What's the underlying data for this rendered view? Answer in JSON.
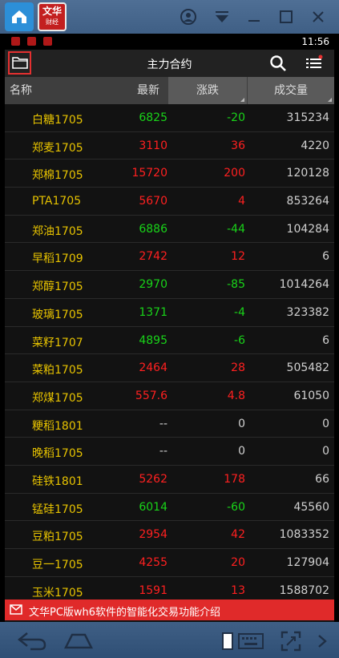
{
  "host": {
    "app_badge_line1": "文华",
    "app_badge_line2": "财经"
  },
  "status": {
    "time": "11:56"
  },
  "appbar": {
    "title": "主力合约"
  },
  "table": {
    "headers": {
      "name": "名称",
      "latest": "最新",
      "change": "涨跌",
      "volume": "成交量"
    },
    "rows": [
      {
        "name": "白糖1705",
        "latest": "6825",
        "change": "-20",
        "volume": "315234",
        "dir": "down"
      },
      {
        "name": "郑麦1705",
        "latest": "3110",
        "change": "36",
        "volume": "4220",
        "dir": "up"
      },
      {
        "name": "郑棉1705",
        "latest": "15720",
        "change": "200",
        "volume": "120128",
        "dir": "up"
      },
      {
        "name": "PTA1705",
        "latest": "5670",
        "change": "4",
        "volume": "853264",
        "dir": "up"
      },
      {
        "name": "郑油1705",
        "latest": "6886",
        "change": "-44",
        "volume": "104284",
        "dir": "down"
      },
      {
        "name": "早稻1709",
        "latest": "2742",
        "change": "12",
        "volume": "6",
        "dir": "up"
      },
      {
        "name": "郑醇1705",
        "latest": "2970",
        "change": "-85",
        "volume": "1014264",
        "dir": "down"
      },
      {
        "name": "玻璃1705",
        "latest": "1371",
        "change": "-4",
        "volume": "323382",
        "dir": "down"
      },
      {
        "name": "菜籽1707",
        "latest": "4895",
        "change": "-6",
        "volume": "6",
        "dir": "down"
      },
      {
        "name": "菜粕1705",
        "latest": "2464",
        "change": "28",
        "volume": "505482",
        "dir": "up"
      },
      {
        "name": "郑煤1705",
        "latest": "557.6",
        "change": "4.8",
        "volume": "61050",
        "dir": "up"
      },
      {
        "name": "粳稻1801",
        "latest": "--",
        "change": "0",
        "volume": "0",
        "dir": "flat"
      },
      {
        "name": "晚稻1705",
        "latest": "--",
        "change": "0",
        "volume": "0",
        "dir": "flat"
      },
      {
        "name": "硅铁1801",
        "latest": "5262",
        "change": "178",
        "volume": "66",
        "dir": "up"
      },
      {
        "name": "锰硅1705",
        "latest": "6014",
        "change": "-60",
        "volume": "45560",
        "dir": "down"
      },
      {
        "name": "豆粕1705",
        "latest": "2954",
        "change": "42",
        "volume": "1083352",
        "dir": "up"
      },
      {
        "name": "豆一1705",
        "latest": "4255",
        "change": "20",
        "volume": "127904",
        "dir": "up"
      },
      {
        "name": "玉米1705",
        "latest": "1591",
        "change": "13",
        "volume": "1588702",
        "dir": "up"
      }
    ]
  },
  "banner": {
    "text": "文华PC版wh6软件的智能化交易功能介绍"
  },
  "colors": {
    "up": "#ff2020",
    "down": "#19d419",
    "name": "#e6c200",
    "banner": "#e02a2a"
  }
}
